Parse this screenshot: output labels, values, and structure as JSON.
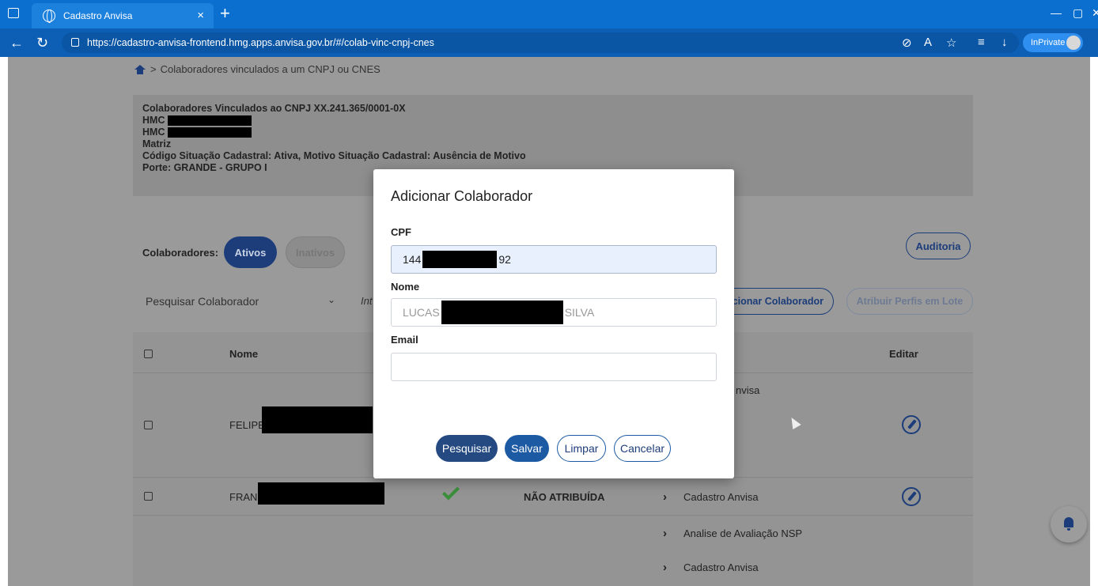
{
  "browser": {
    "tab_title": "Cadastro Anvisa",
    "tab_close": "×",
    "new_tab": "+",
    "url": "https://cadastro-anvisa-frontend.hmg.apps.anvisa.gov.br/#/colab-vinc-cnpj-cnes",
    "inprivate_label": "InPrivate",
    "window_controls": [
      "—",
      "▢",
      "✕"
    ]
  },
  "page": {
    "breadcrumb_sep": ">",
    "breadcrumb_text": "Colaboradores vinculados a um CNPJ ou CNES",
    "info": {
      "line1": "Colaboradores Vinculados ao CNPJ XX.241.365/0001-0X",
      "line2": "HMC",
      "line3": "HMC",
      "line4": "Matriz",
      "line5": "Código Situação Cadastral: Ativa, Motivo Situação Cadastral: Ausência de Motivo",
      "line6": "Porte: GRANDE - GRUPO I"
    },
    "colab_label": "Colaboradores:",
    "btn_ativos": "Ativos",
    "btn_inativos": "Inativos",
    "btn_auditoria": "Auditoria",
    "search_select": "Pesquisar Colaborador",
    "search_input_fragment": "Int",
    "btn_add_fragment": "cionar Colaborador",
    "btn_lote": "Atribuir Perfis em Lote"
  },
  "table": {
    "headers": {
      "nome": "Nome",
      "editar": "Editar"
    },
    "rows": [
      {
        "nome_prefix": "FELIPE",
        "perfil_fragment": "nvisa"
      },
      {
        "nome_prefix": "FRAN",
        "situacao": "NÃO ATRIBUÍDA",
        "perfil": "Cadastro Anvisa"
      }
    ],
    "sub_items": [
      "Analise de Avaliação NSP",
      "Cadastro Anvisa"
    ]
  },
  "modal": {
    "title": "Adicionar Colaborador",
    "cpf_label": "CPF",
    "cpf_prefix": "144",
    "cpf_suffix": "92",
    "nome_label": "Nome",
    "nome_prefix": "LUCAS",
    "nome_suffix": "SILVA",
    "email_label": "Email",
    "email_value": "",
    "btn_pesquisar": "Pesquisar",
    "btn_salvar": "Salvar",
    "btn_limpar": "Limpar",
    "btn_cancelar": "Cancelar"
  },
  "colors": {
    "primary": "#1c3d7a",
    "tabbar": "#0a6fcf",
    "check": "#3a8f3a"
  }
}
